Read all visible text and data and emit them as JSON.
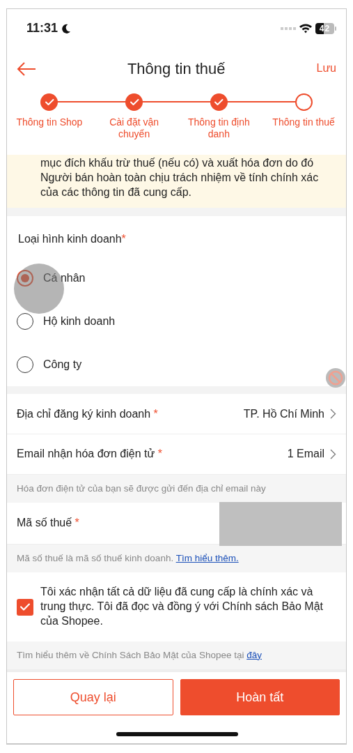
{
  "status_bar": {
    "time": "11:31",
    "battery": "42"
  },
  "header": {
    "title": "Thông tin thuế",
    "action": "Lưu"
  },
  "steps": [
    {
      "label": "Thông tin Shop",
      "done": true
    },
    {
      "label": "Cài đặt vận chuyển",
      "done": true
    },
    {
      "label": "Thông tin định danh",
      "done": true
    },
    {
      "label": "Thông tin thuế",
      "done": false
    }
  ],
  "notice": "mục đích khấu trừ thuế (nếu có) và xuất hóa đơn do đó Người bán hoàn toàn chịu trách nhiệm về tính chính xác của các thông tin đã cung cấp.",
  "business_type": {
    "label": "Loại hình kinh doanh",
    "required_mark": "*",
    "options": [
      {
        "label": "Cá nhân",
        "selected": true
      },
      {
        "label": "Hộ kinh doanh",
        "selected": false
      },
      {
        "label": "Công ty",
        "selected": false
      }
    ]
  },
  "fields": [
    {
      "kind": "select",
      "label": "Địa chỉ đăng ký kinh doanh",
      "required_mark": "*",
      "value": "TP. Hồ Chí Minh"
    },
    {
      "kind": "select",
      "label": "Email nhận hóa đơn điện tử",
      "required_mark": "*",
      "value": "1 Email",
      "hint": "Hóa đơn điện tử của bạn sẽ được gửi đến địa chỉ email này"
    },
    {
      "kind": "input",
      "label": "Mã số thuế",
      "required_mark": "*",
      "hint": "Mã số thuế là mã số thuế kinh doanh.",
      "hint_link": "Tìm hiểu thêm."
    }
  ],
  "consent": {
    "checked": true,
    "text": "Tôi xác nhận tất cả dữ liệu đã cung cấp là chính xác và trung thực. Tôi đã đọc và đồng ý với Chính sách Bảo Mật của Shopee."
  },
  "policy_note": {
    "text": "Tìm hiểu thêm về Chính Sách Bảo Mật của Shopee tại",
    "link": "đây"
  },
  "buttons": [
    {
      "kind": "secondary",
      "label": "Quay lại"
    },
    {
      "kind": "primary",
      "label": "Hoàn tất"
    }
  ]
}
